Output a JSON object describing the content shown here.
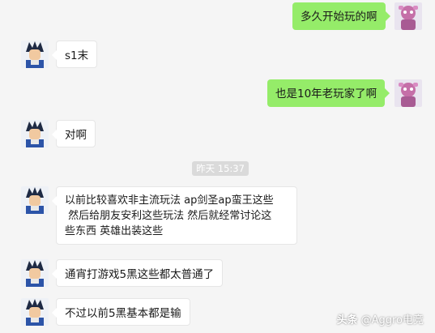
{
  "chat": {
    "messages": [
      {
        "sender": "self",
        "text": "多久开始玩的啊"
      },
      {
        "sender": "other",
        "text": "s1末"
      },
      {
        "sender": "self",
        "text": "也是10年老玩家了啊"
      },
      {
        "sender": "other",
        "text": "对啊"
      },
      {
        "type": "timestamp",
        "text": "昨天 15:37"
      },
      {
        "sender": "other",
        "text": "以前比较喜欢非主流玩法 ap剑圣ap蛮王这些\n 然后给朋友安利这些玩法 然后就经常讨论这\n些东西 英雄出装这些"
      },
      {
        "sender": "other",
        "text": "通宵打游戏5黑这些都太普通了"
      },
      {
        "sender": "other",
        "text": "不过以前5黑基本都是输"
      }
    ]
  },
  "watermark": {
    "brand": "头条",
    "handle": "@Aggro电竞"
  },
  "colors": {
    "background": "#f5f5f5",
    "self_bubble": "#95ec69",
    "other_bubble": "#ffffff",
    "timestamp_bg": "#dadada"
  },
  "icons": {
    "other_avatar": "anime-character-avatar",
    "self_avatar": "pink-figure-avatar"
  }
}
